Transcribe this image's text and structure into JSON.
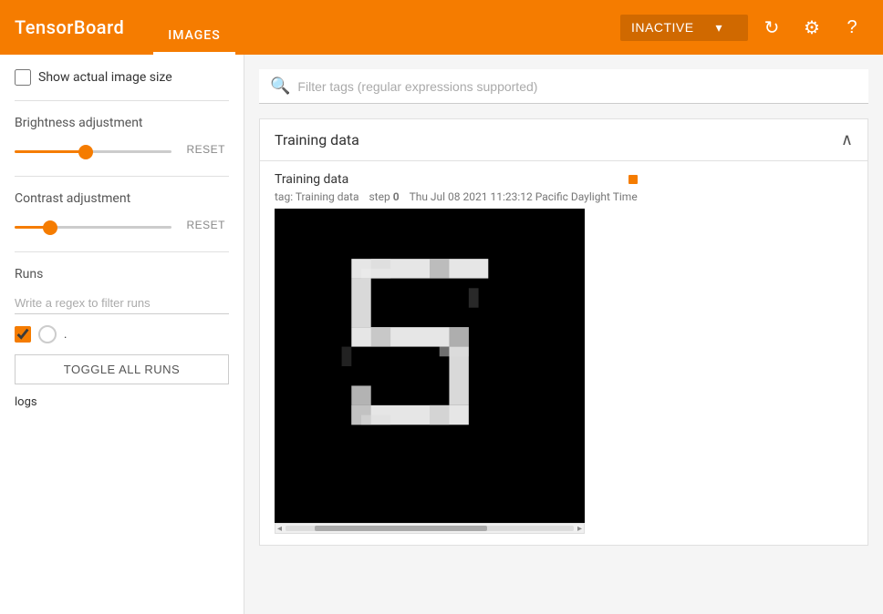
{
  "header": {
    "logo": "TensorBoard",
    "nav_item": "IMAGES",
    "inactive_label": "INACTIVE",
    "refresh_icon": "↻",
    "settings_icon": "⚙",
    "help_icon": "?"
  },
  "sidebar": {
    "show_actual_size_label": "Show actual image size",
    "brightness_label": "Brightness adjustment",
    "brightness_reset": "RESET",
    "contrast_label": "Contrast adjustment",
    "contrast_reset": "RESET",
    "runs_label": "Runs",
    "runs_filter_placeholder": "Write a regex to filter runs",
    "toggle_all_label": "TOGGLE ALL RUNS",
    "run_dot": ".",
    "log_item": "logs"
  },
  "main": {
    "search_placeholder": "Filter tags (regular expressions supported)",
    "training_panel_title": "Training data",
    "image_card": {
      "title": "Training data",
      "tag": "tag: Training data",
      "step_label": "step",
      "step_value": "0",
      "timestamp": "Thu Jul 08 2021 11:23:12 Pacific Daylight Time"
    }
  }
}
